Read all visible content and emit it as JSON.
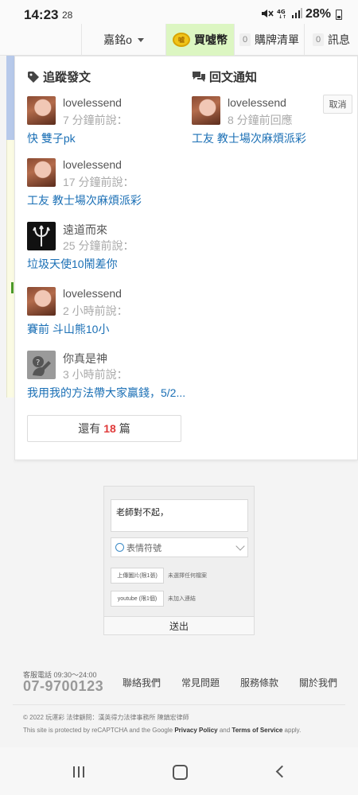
{
  "status_bar": {
    "time": "14:23",
    "sub": "28",
    "icons": [
      "mute-icon",
      "4g-icon",
      "signal-icon"
    ],
    "battery": "28%"
  },
  "header": {
    "user": "嘉銘o",
    "buy_label": "買噓幣",
    "cart_count": "0",
    "cart_label": "購牌清單",
    "msg_count": "0",
    "msg_label": "訊息"
  },
  "follow": {
    "title": "追蹤發文",
    "items": [
      {
        "user": "lovelessend",
        "time": "7 分鐘前說：",
        "title": "快 雙子pk",
        "avatar": "girl"
      },
      {
        "user": "lovelessend",
        "time": "17 分鐘前說：",
        "title": "工友 教士場次麻煩派彩",
        "avatar": "girl"
      },
      {
        "user": "遠道而來",
        "time": "25 分鐘前說：",
        "title": "垃圾天使10鬧差你",
        "avatar": "trident"
      },
      {
        "user": "lovelessend",
        "time": "2 小時前說：",
        "title": "賽前 斗山熊10小",
        "avatar": "girl"
      },
      {
        "user": "你真是神",
        "time": "3 小時前說：",
        "title": "我用我的方法帶大家贏錢，5/2...",
        "avatar": "unknown"
      }
    ],
    "more_prefix": "還有",
    "more_count": "18",
    "more_suffix": "篇"
  },
  "reply": {
    "title": "回文通知",
    "cancel_label": "取消",
    "items": [
      {
        "user": "lovelessend",
        "time": "8 分鐘前回應",
        "title": "工友 教士場次麻煩派彩",
        "avatar": "girl"
      }
    ]
  },
  "form": {
    "text_value": "老師對不起，",
    "emoji_label": "表情符號",
    "upload_label": "上傳圖片(限1張)",
    "upload_note": "未選擇任何檔案",
    "youtube_label": "youtube (限1個)",
    "youtube_note": "未加入連結",
    "submit_label": "送出"
  },
  "footer": {
    "hours": "客服電話 09:30～24:00",
    "phone": "07-9700123",
    "links": [
      "聯絡我們",
      "常見問題",
      "服務條款",
      "關於我們"
    ],
    "copyright": "© 2022 玩運彩 法律顧問：漢英得力法律事務所 陳鎮宏律師",
    "recaptcha_pre": "This site is protected by reCAPTCHA and the Google",
    "privacy": "Privacy Policy",
    "and": "and",
    "terms": "Terms of Service",
    "apply": "apply."
  }
}
